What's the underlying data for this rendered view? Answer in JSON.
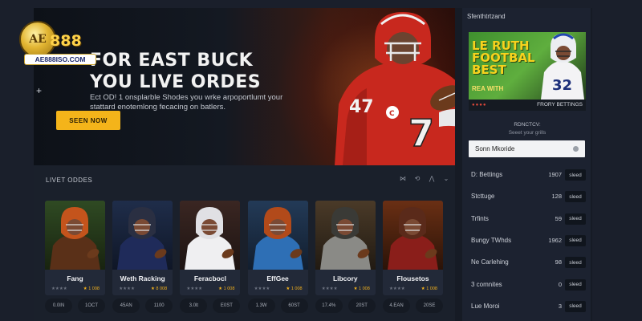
{
  "hero": {
    "title_line1": "FOR  EAST BUCK",
    "title_line2": "YOU LIVE ORDES",
    "subtitle": "Ect OD! 1 onsplarble Shodes you wrke arpoportlumt your stattard enotemlong fecacing on batlers.",
    "cta": "SEEN NOW",
    "plus": "+"
  },
  "logo": {
    "mark": "AE",
    "number": "888",
    "domain": "AE888ISO.COM"
  },
  "sidebar": {
    "title": "Sfenthtrtzand",
    "promo": {
      "headline": "LE RUTH FOOTBAL BEST",
      "subline": "REA WITH",
      "dots": "●●●●",
      "label": "FRORY BETTINGS"
    },
    "sub1": "RDNCTCV:",
    "sub2": "Seeet your grills",
    "select_label": "Sonn Mkoride",
    "stats": [
      {
        "label": "D: Bettings",
        "value": "1907",
        "button": "sleed"
      },
      {
        "label": "Stcttuge",
        "value": "128",
        "button": "sleed"
      },
      {
        "label": "Trfints",
        "value": "59",
        "button": "sleed"
      },
      {
        "label": "Bungy TWhds",
        "value": "1962",
        "button": "sleed"
      },
      {
        "label": "Ne Carlehing",
        "value": "98",
        "button": "sleed"
      },
      {
        "label": "3 comnites",
        "value": "0",
        "button": "sleed"
      },
      {
        "label": "Lue Moroi",
        "value": "3",
        "button": "sleed"
      }
    ]
  },
  "odds": {
    "title": "LIVET ODDES",
    "icons": [
      "filter-icon",
      "swap-icon",
      "grid-icon",
      "chevron-down-icon"
    ],
    "icon_glyphs": [
      "⋈",
      "⟲",
      "⋀",
      "⌄"
    ],
    "cards": [
      {
        "name": "Fang",
        "rating_left": "★★★★",
        "rating_right": "★ 1 008",
        "odd1": "0.0IN",
        "odd2": "1OCT",
        "jersey": "#5a3018",
        "helmet": "#c4541c",
        "bg1": "#2f4a23",
        "bg2": "#18230f"
      },
      {
        "name": "Weth Racking",
        "rating_left": "★★★★",
        "rating_right": "★ 8 008",
        "odd1": "45AN",
        "odd2": "1100",
        "jersey": "#1f2b5a",
        "helmet": "#2a2f42",
        "bg1": "#1f2d4a",
        "bg2": "#0f1626"
      },
      {
        "name": "Feracbocl",
        "rating_left": "★★★★",
        "rating_right": "★ 1 008",
        "odd1": "3.0lt",
        "odd2": "E0ST",
        "jersey": "#efeff1",
        "helmet": "#e0e0e4",
        "bg1": "#3a2622",
        "bg2": "#1d1412"
      },
      {
        "name": "EffGee",
        "rating_left": "★★★★",
        "rating_right": "★ 1 008",
        "odd1": "1.3W",
        "odd2": "60ST",
        "jersey": "#2e6fb5",
        "helmet": "#b24a1a",
        "bg1": "#233a57",
        "bg2": "#121e2e"
      },
      {
        "name": "Libcory",
        "rating_left": "★★★★",
        "rating_right": "★ 1 008",
        "odd1": "17.4%",
        "odd2": "20ST",
        "jersey": "#8a8a86",
        "helmet": "#3a3a36",
        "bg1": "#4a3a28",
        "bg2": "#211a12"
      },
      {
        "name": "Flousetos",
        "rating_left": "★★★★",
        "rating_right": "★ 1 008",
        "odd1": "4.EAN",
        "odd2": "20SE",
        "jersey": "#8a1e1a",
        "helmet": "#5a2a1a",
        "bg1": "#6a2f14",
        "bg2": "#2a1308"
      }
    ]
  },
  "colors": {
    "accent": "#f4b41a",
    "background": "#1a1f2b",
    "hero_jersey": "#c8281e"
  }
}
